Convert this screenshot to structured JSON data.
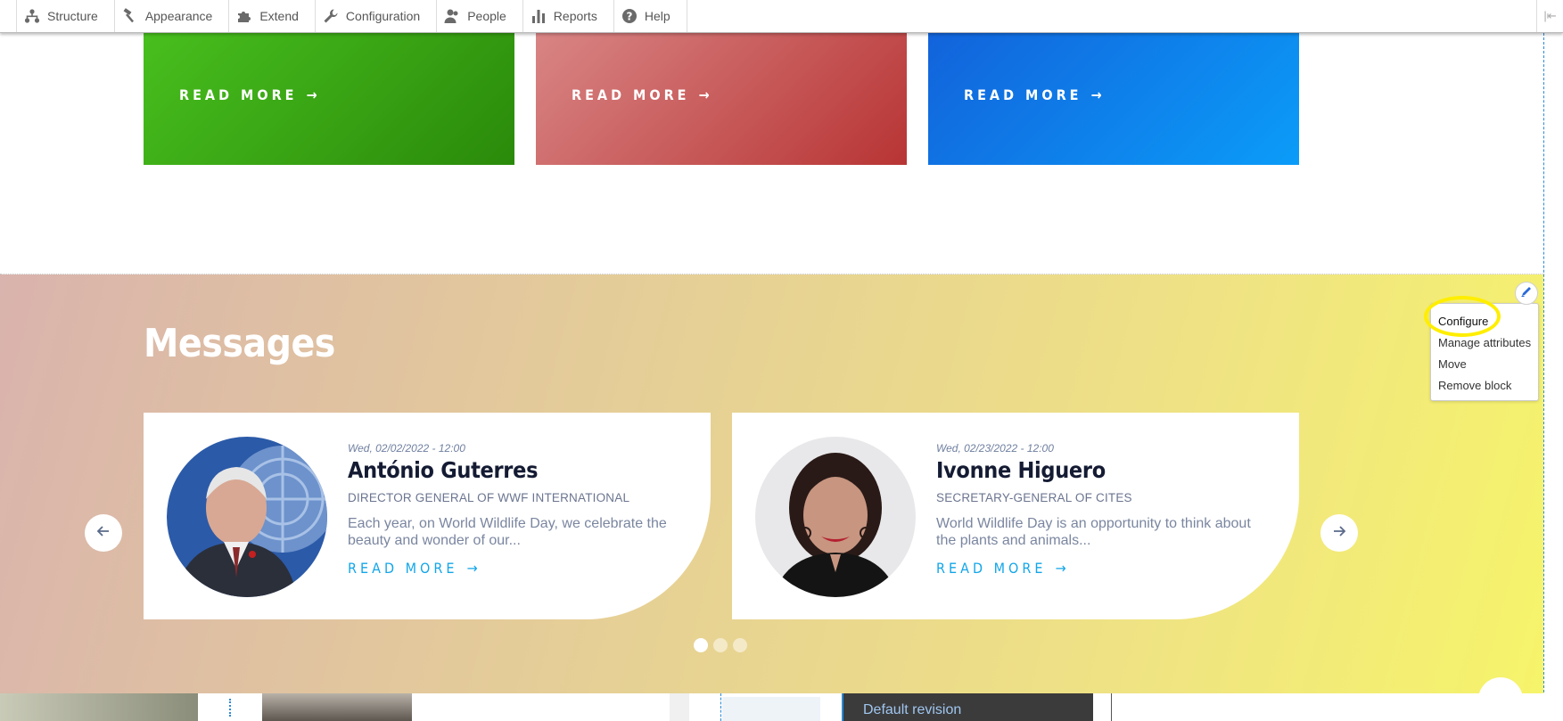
{
  "toolbar": {
    "items": [
      {
        "label": "Structure",
        "icon": "structure-icon"
      },
      {
        "label": "Appearance",
        "icon": "appearance-icon"
      },
      {
        "label": "Extend",
        "icon": "puzzle-icon"
      },
      {
        "label": "Configuration",
        "icon": "wrench-icon"
      },
      {
        "label": "People",
        "icon": "person-icon"
      },
      {
        "label": "Reports",
        "icon": "bar-chart-icon"
      },
      {
        "label": "Help",
        "icon": "help-icon"
      }
    ]
  },
  "cards": [
    {
      "link_label": "READ MORE",
      "color": "#3aab16"
    },
    {
      "link_label": "READ MORE",
      "color": "#c95a5a"
    },
    {
      "link_label": "READ MORE",
      "color": "#0a7ff0"
    }
  ],
  "messages": {
    "title": "Messages",
    "items": [
      {
        "date": "Wed, 02/02/2022 - 12:00",
        "name": "António Guterres",
        "role": "DIRECTOR GENERAL OF WWF INTERNATIONAL",
        "excerpt": "Each year, on World Wildlife Day, we celebrate the beauty and wonder of our...",
        "link_label": "READ MORE"
      },
      {
        "date": "Wed, 02/23/2022 - 12:00",
        "name": "Ivonne Higuero",
        "role": "SECRETARY-GENERAL OF CITES",
        "excerpt": "World Wildlife Day is an opportunity to think about the plants and animals...",
        "link_label": "READ MORE"
      }
    ],
    "slider": {
      "pages": 3,
      "active": 1
    }
  },
  "context_menu": {
    "items": [
      "Configure",
      "Manage attributes",
      "Move",
      "Remove block"
    ]
  },
  "bottom": {
    "revision_label": "Default revision"
  },
  "colors": {
    "accent_link": "#13a6e8",
    "highlight_ring": "#ffee00"
  }
}
